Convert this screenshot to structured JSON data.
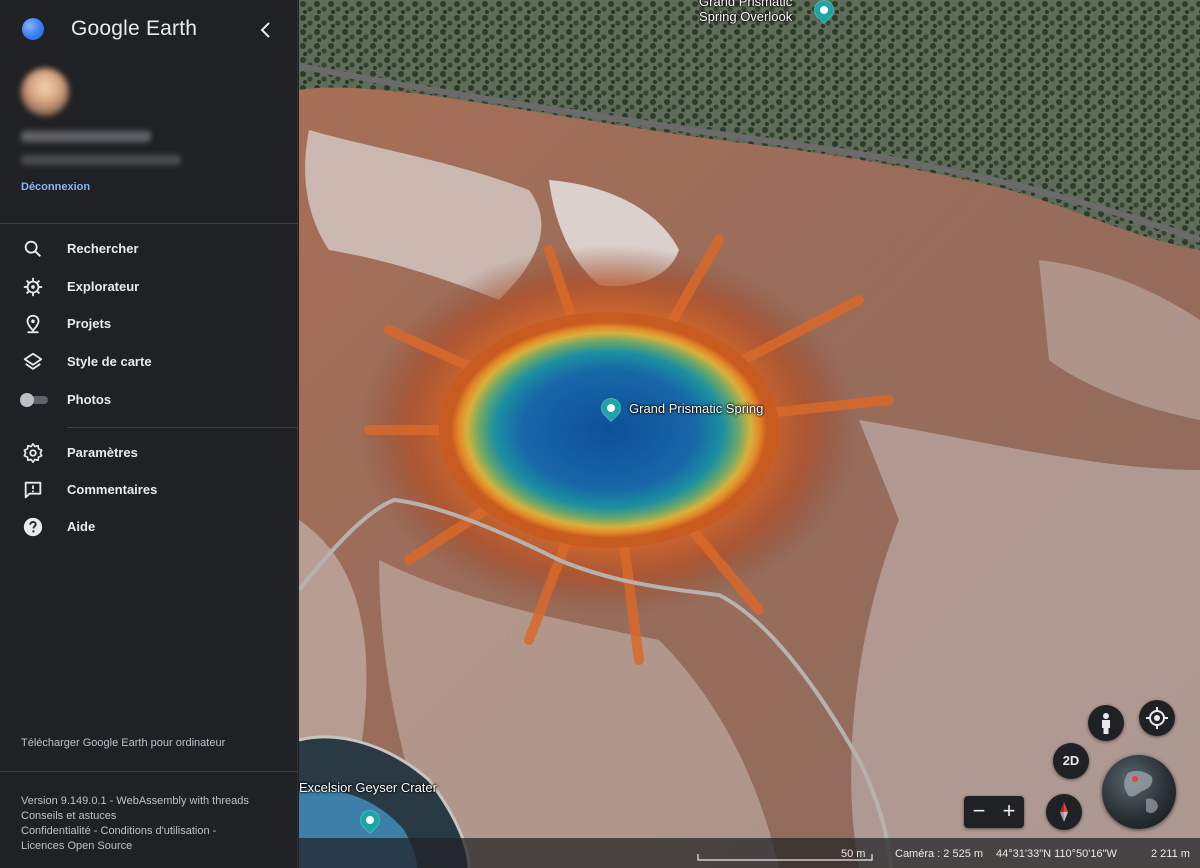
{
  "app": {
    "title": "Google Earth"
  },
  "user": {
    "logout_label": "Déconnexion"
  },
  "menu": {
    "items": [
      {
        "id": "search",
        "label": "Rechercher",
        "icon": "search-icon"
      },
      {
        "id": "explorer",
        "label": "Explorateur",
        "icon": "explorer-icon"
      },
      {
        "id": "projects",
        "label": "Projets",
        "icon": "projects-pin-icon"
      },
      {
        "id": "map-style",
        "label": "Style de carte",
        "icon": "layers-icon"
      },
      {
        "id": "photos",
        "label": "Photos",
        "icon": "toggle-switch",
        "toggle_on": false
      }
    ],
    "secondary": [
      {
        "id": "settings",
        "label": "Paramètres",
        "icon": "gear-icon"
      },
      {
        "id": "feedback",
        "label": "Commentaires",
        "icon": "feedback-icon"
      },
      {
        "id": "help",
        "label": "Aide",
        "icon": "help-icon"
      }
    ]
  },
  "download_label": "Télécharger Google Earth pour ordinateur",
  "footer": {
    "version": "Version 9.149.0.1 - WebAssembly with threads",
    "tips": "Conseils et astuces",
    "privacy": "Confidentialité",
    "sep": " - ",
    "terms": "Conditions d'utilisation",
    "sep2": " -",
    "licenses": "Licences Open Source"
  },
  "map": {
    "labels": {
      "overlook_line1": "Grand Prismatic",
      "overlook_line2": "Spring Overlook",
      "main": "Grand Prismatic Spring",
      "crater": "Excelsior Geyser Crater"
    },
    "controls": {
      "mode_2d": "2D",
      "zoom_out": "−",
      "zoom_in": "+"
    },
    "status": {
      "scale": "50 m",
      "camera": "Caméra : 2 525 m",
      "coords": "44°31'33\"N 110°50'16\"W",
      "altitude": "2 211 m"
    }
  },
  "colors": {
    "accent": "#8ab4f8",
    "sidebar_bg": "#202124",
    "pin": "#1aa6a6"
  }
}
